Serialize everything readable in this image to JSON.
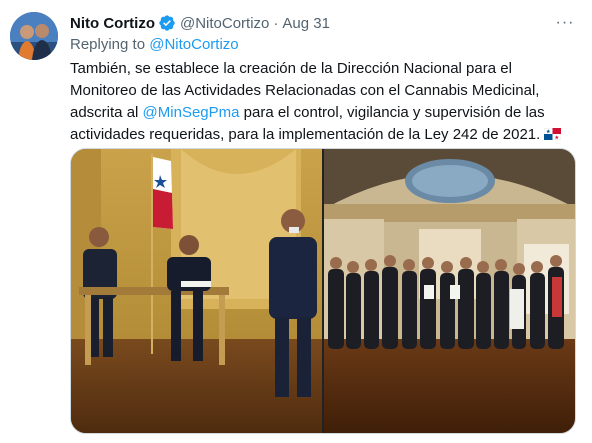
{
  "author": {
    "name": "Nito Cortizo",
    "handle": "@NitoCortizo",
    "separator": "·",
    "date": "Aug 31"
  },
  "reply": {
    "prefix": "Replying to ",
    "to": "@NitoCortizo"
  },
  "body": {
    "part1": "También, se establece la creación de la Dirección Nacional para el Monitoreo de las Actividades Relacionadas con el Cannabis Medicinal, adscrita al ",
    "mention": "@MinSegPma",
    "part2": " para el control, vigilancia y supervisión de las actividades requeridas, para la implementación de la Ley 242 de 2021."
  },
  "more_label": "···",
  "icons": {
    "verified": "verified-badge-icon",
    "flag": "panama-flag-icon",
    "more": "more-options-icon"
  },
  "colors": {
    "link": "#1d9bf0",
    "secondary_text": "#536471",
    "primary_text": "#0f1419"
  }
}
